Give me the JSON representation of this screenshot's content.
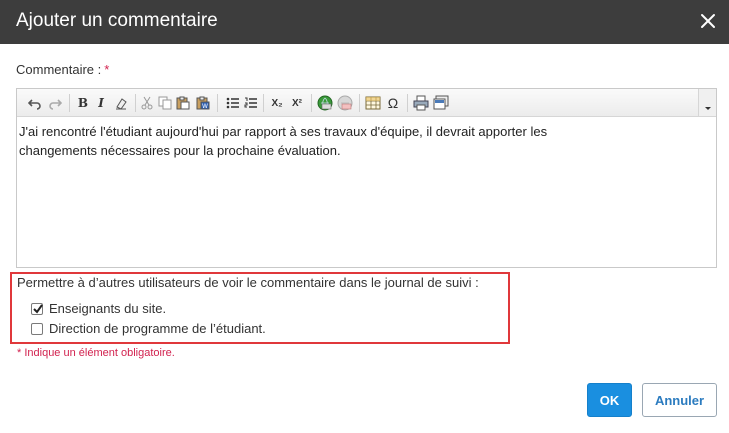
{
  "dialog": {
    "title": "Ajouter un commentaire"
  },
  "comment": {
    "label": "Commentaire :",
    "required_marker": "*",
    "text_line1": "J'ai rencontré l'étudiant aujourd'hui par rapport à ses travaux d'équipe,  il devrait apporter les",
    "text_line2": "changements nécessaires pour la prochaine évaluation."
  },
  "toolbar": {
    "icons": [
      "undo-icon",
      "redo-icon",
      "bold-icon",
      "italic-icon",
      "remove-format-icon",
      "cut-icon",
      "copy-icon",
      "paste-icon",
      "paste-word-icon",
      "bulleted-list-icon",
      "numbered-list-icon",
      "subscript-icon",
      "superscript-icon",
      "link-icon",
      "unlink-icon",
      "table-icon",
      "special-char-icon",
      "print-icon",
      "preview-icon",
      "collapse-icon"
    ],
    "bold_glyph": "B",
    "italic_glyph": "I",
    "subscript_glyph": "X₂",
    "superscript_glyph": "X²",
    "omega_glyph": "Ω"
  },
  "permissions": {
    "prompt": "Permettre à d’autres utilisateurs de voir le commentaire dans le journal de suivi :",
    "options": [
      {
        "label": "Enseignants du site.",
        "checked": true
      },
      {
        "label": "Direction de programme de l’étudiant.",
        "checked": false
      }
    ]
  },
  "required_note": "* Indique un élément obligatoire.",
  "buttons": {
    "ok": "OK",
    "cancel": "Annuler"
  },
  "colors": {
    "titlebar": "#3d3d3d",
    "required": "#d2224f",
    "primary": "#1a8fe0",
    "highlight_border": "#e0383b"
  }
}
